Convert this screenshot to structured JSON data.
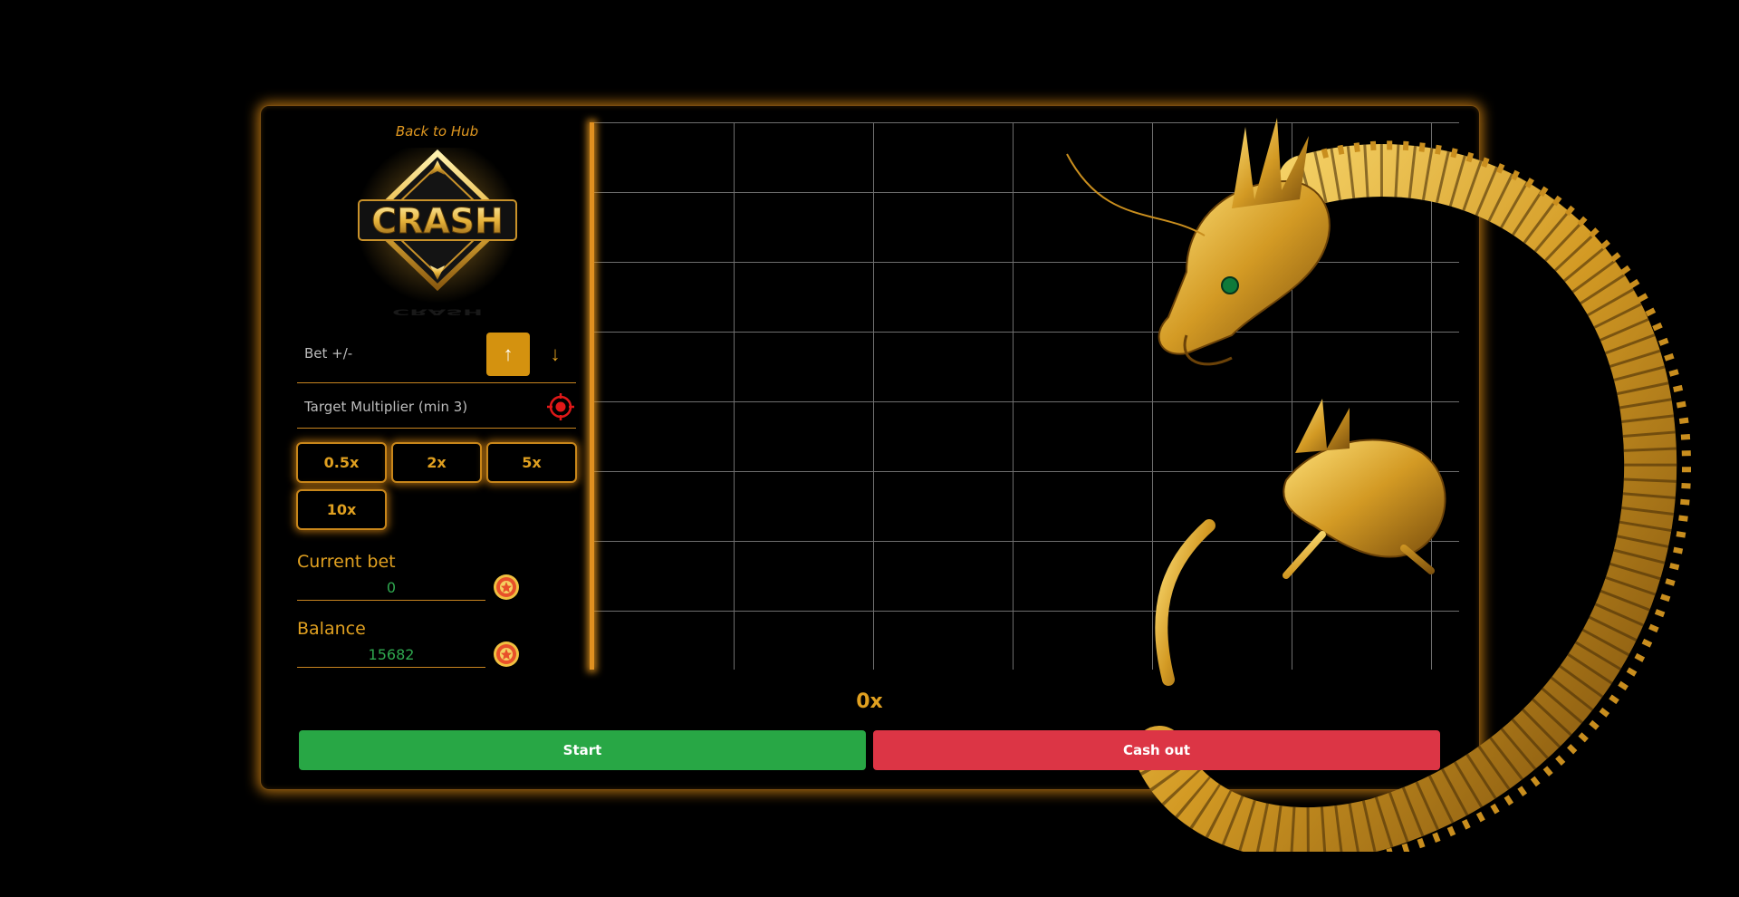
{
  "header": {
    "back_link": "Back to Hub"
  },
  "logo": {
    "text": "CRASH"
  },
  "bet_control": {
    "label": "Bet +/-",
    "up_symbol": "↑",
    "down_symbol": "↓"
  },
  "target": {
    "label": "Target Multiplier (min 3)",
    "icon": "target-icon"
  },
  "multiplier_buttons": [
    {
      "label": "0.5x"
    },
    {
      "label": "2x"
    },
    {
      "label": "5x"
    },
    {
      "label": "10x"
    }
  ],
  "current_bet": {
    "label": "Current bet",
    "value": "0",
    "icon": "chip-icon"
  },
  "balance": {
    "label": "Balance",
    "value": "15682",
    "icon": "chip-icon"
  },
  "game": {
    "multiplier_display": "0x"
  },
  "actions": {
    "start_label": "Start",
    "cashout_label": "Cash out"
  },
  "colors": {
    "accent": "#e0a020",
    "start": "#28a745",
    "cashout": "#dc3545",
    "value_text": "#2fa84f",
    "background": "#000000"
  }
}
